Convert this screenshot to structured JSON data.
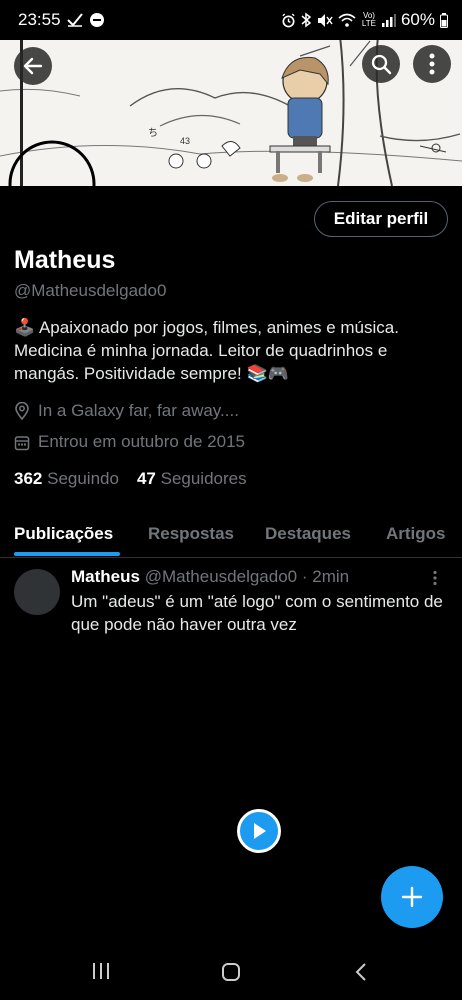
{
  "status": {
    "time": "23:55",
    "battery": "60%",
    "network": "Vo) LTE",
    "icons": [
      "check-icon",
      "dnd-icon",
      "alarm-icon",
      "bluetooth-icon",
      "mute-icon",
      "wifi-icon",
      "signal-icon",
      "battery-icon"
    ]
  },
  "header": {
    "back_icon": "arrow-left-icon",
    "search_icon": "search-icon",
    "more_icon": "more-vertical-icon"
  },
  "profile": {
    "edit_button": "Editar perfil",
    "name": "Matheus",
    "handle": "@Matheusdelgado0",
    "bio": "🕹️ Apaixonado por jogos, filmes, animes e música. Medicina é minha jornada. Leitor de quadrinhos e mangás. Positividade sempre! 📚🎮",
    "location": "In a Galaxy far, far away....",
    "joined": "Entrou em outubro de 2015",
    "following_count": "362",
    "following_label": "Seguindo",
    "followers_count": "47",
    "followers_label": "Seguidores"
  },
  "tabs": [
    {
      "label": "Publicações",
      "active": true
    },
    {
      "label": "Respostas",
      "active": false
    },
    {
      "label": "Destaques",
      "active": false
    },
    {
      "label": "Artigos",
      "active": false
    }
  ],
  "post": {
    "author": "Matheus",
    "handle": "@Matheusdelgado0",
    "time": "· 2min",
    "text": "Um \"adeus\" é um \"até logo\" com o sentimento de que pode não haver outra vez"
  },
  "colors": {
    "accent": "#1d9bf0",
    "background": "#000000",
    "secondary_text": "#71767b",
    "border": "#2f3336"
  }
}
